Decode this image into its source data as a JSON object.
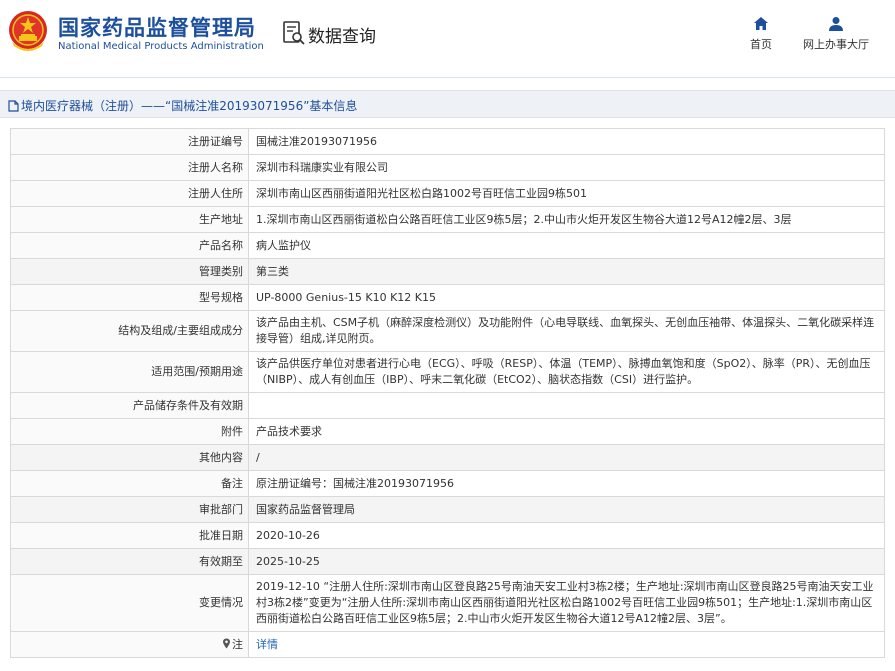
{
  "header": {
    "brand_cn": "国家药品监督管理局",
    "brand_en": "National Medical Products Administration",
    "query_title": "数据查询",
    "brand_color": "#1d4f9c",
    "nav": [
      {
        "label": "首页",
        "icon": "home-icon"
      },
      {
        "label": "网上办事大厅",
        "icon": "user-icon"
      }
    ]
  },
  "breadcrumb": {
    "text": "境内医疗器械（注册）——“国械注准20193071956”基本信息",
    "icon": "document-icon"
  },
  "table": {
    "rows": [
      {
        "label": "注册证编号",
        "value": "国械注准20193071956"
      },
      {
        "label": "注册人名称",
        "value": "深圳市科瑞康实业有限公司"
      },
      {
        "label": "注册人住所",
        "value": "深圳市南山区西丽街道阳光社区松白路1002号百旺信工业园9栋501"
      },
      {
        "label": "生产地址",
        "value": "1.深圳市南山区西丽街道松白公路百旺信工业区9栋5层；2.中山市火炬开发区生物谷大道12号A12幢2层、3层"
      },
      {
        "label": "产品名称",
        "value": "病人监护仪"
      },
      {
        "label": "管理类别",
        "value": "第三类"
      },
      {
        "label": "型号规格",
        "value": "UP-8000 Genius-15 K10 K12 K15"
      },
      {
        "label": "结构及组成/主要组成成分",
        "value": "该产品由主机、CSM子机（麻醉深度检测仪）及功能附件（心电导联线、血氧探头、无创血压袖带、体温探头、二氧化碳采样连接导管）组成,详见附页。"
      },
      {
        "label": "适用范围/预期用途",
        "value": "该产品供医疗单位对患者进行心电（ECG）、呼吸（RESP）、体温（TEMP）、脉搏血氧饱和度（SpO2）、脉率（PR）、无创血压（NIBP）、成人有创血压（IBP）、呼末二氧化碳（EtCO2）、脑状态指数（CSI）进行监护。"
      },
      {
        "label": "产品储存条件及有效期",
        "value": ""
      },
      {
        "label": "附件",
        "value": "产品技术要求"
      },
      {
        "label": "其他内容",
        "value": "/"
      },
      {
        "label": "备注",
        "value": "原注册证编号：国械注准20193071956"
      },
      {
        "label": "审批部门",
        "value": "国家药品监督管理局"
      },
      {
        "label": "批准日期",
        "value": "2020-10-26"
      },
      {
        "label": "有效期至",
        "value": "2025-10-25"
      },
      {
        "label": "变更情况",
        "value": "2019-12-10 “注册人住所:深圳市南山区登良路25号南油天安工业村3栋2楼；生产地址:深圳市南山区登良路25号南油天安工业村3栋2楼”变更为“注册人住所:深圳市南山区西丽街道阳光社区松白路1002号百旺信工业园9栋501；生产地址:1.深圳市南山区西丽街道松白公路百旺信工业区9栋5层；2.中山市火炬开发区生物谷大道12号A12幢2层、3层”。"
      },
      {
        "label": "注",
        "value": "详情",
        "icon": "pin-icon"
      }
    ]
  }
}
